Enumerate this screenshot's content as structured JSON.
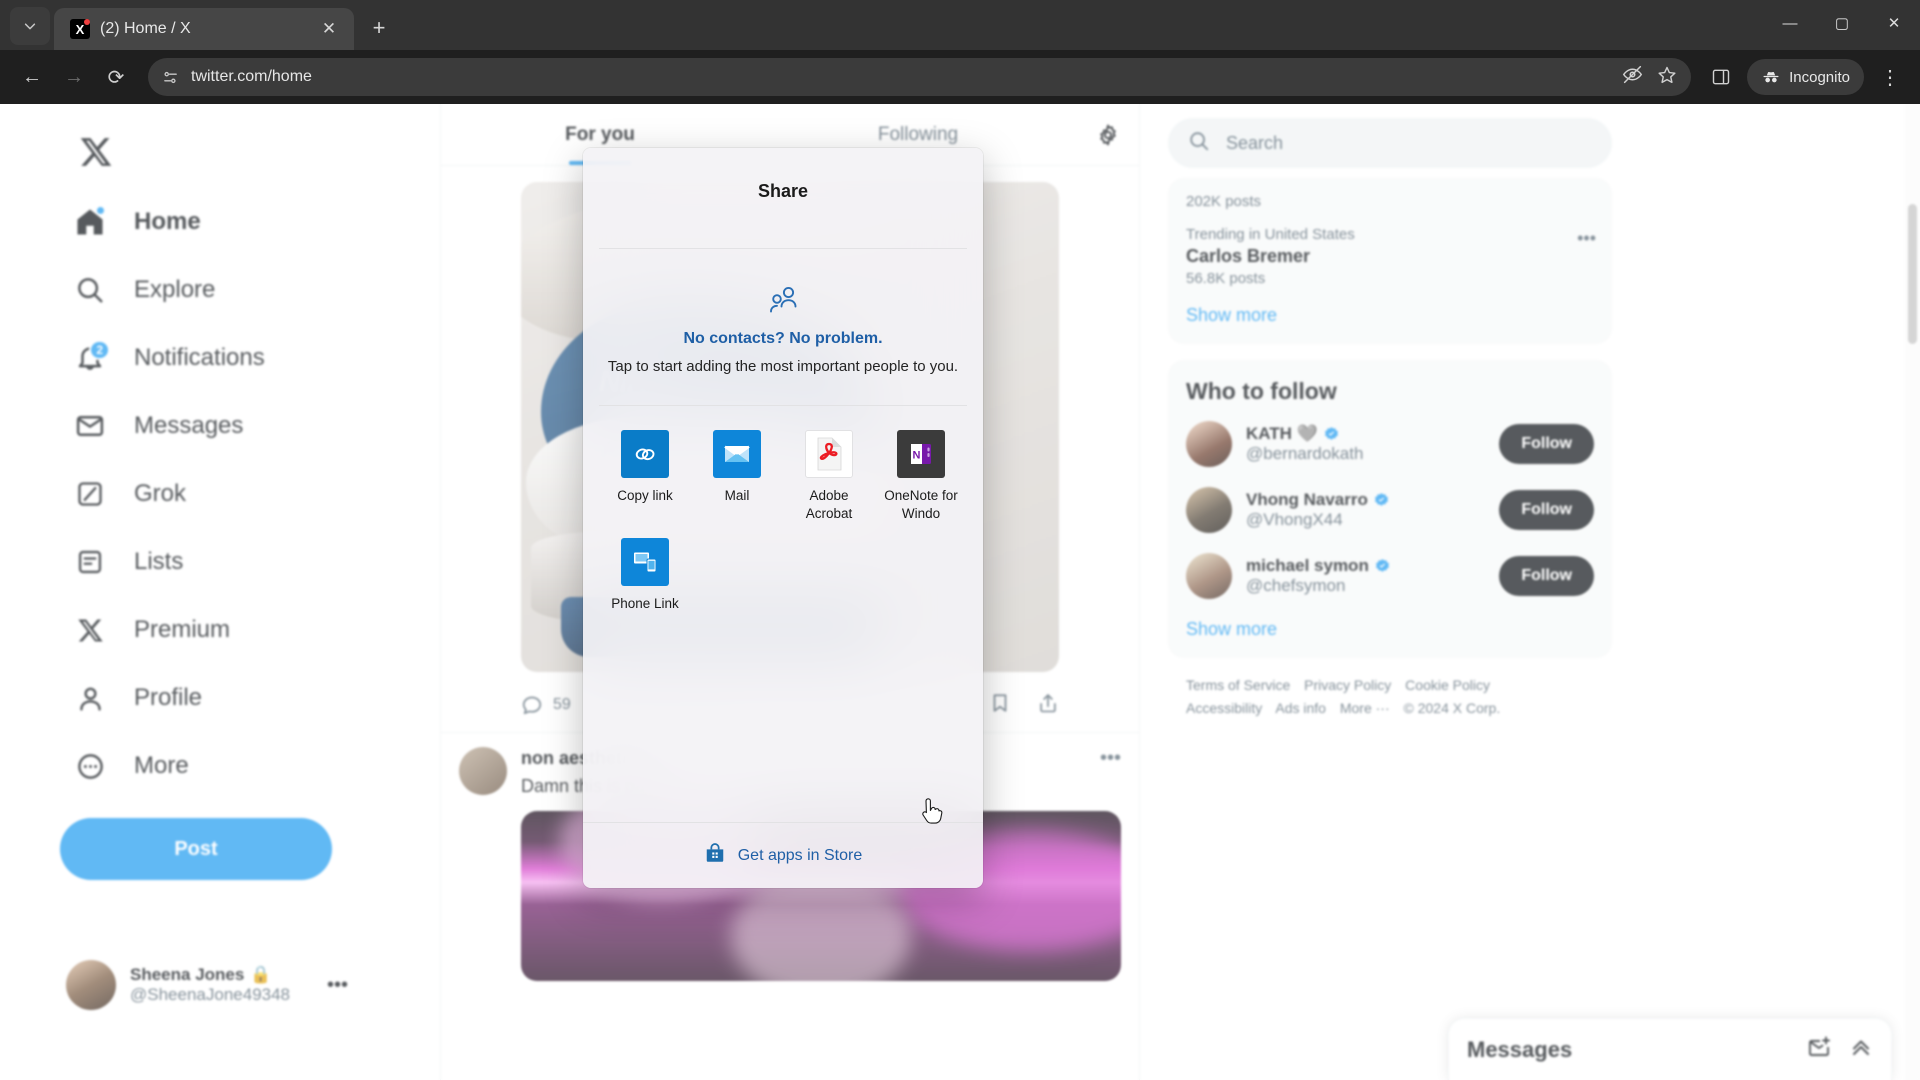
{
  "browser": {
    "tab": {
      "title": "(2) Home / X",
      "favicon_letter": "X"
    },
    "new_tab_label": "+",
    "nav": {
      "back": "←",
      "forward": "→",
      "reload": "⟳"
    },
    "omnibox": {
      "url": "twitter.com/home"
    },
    "incognito_label": "Incognito",
    "window_controls": {
      "minimize": "—",
      "maximize": "▢",
      "close": "✕"
    }
  },
  "sidebar": {
    "logo": "X",
    "items": [
      {
        "label": "Home",
        "icon": "home-icon",
        "badge": "",
        "active": true
      },
      {
        "label": "Explore",
        "icon": "search-icon",
        "badge": ""
      },
      {
        "label": "Notifications",
        "icon": "bell-icon",
        "badge": "2"
      },
      {
        "label": "Messages",
        "icon": "envelope-icon",
        "badge": ""
      },
      {
        "label": "Grok",
        "icon": "grok-icon",
        "badge": ""
      },
      {
        "label": "Lists",
        "icon": "lists-icon",
        "badge": ""
      },
      {
        "label": "Premium",
        "icon": "x-premium-icon",
        "badge": ""
      },
      {
        "label": "Profile",
        "icon": "person-icon",
        "badge": ""
      },
      {
        "label": "More",
        "icon": "more-circle-icon",
        "badge": ""
      }
    ],
    "post_button": "Post",
    "account": {
      "name": "Sheena Jones",
      "handle": "@SheenaJone49348",
      "lock": "🔒",
      "more": "•••"
    }
  },
  "feed": {
    "tabs": [
      {
        "label": "For you",
        "active": true
      },
      {
        "label": "Following",
        "active": false
      }
    ],
    "settings_icon": "gear-icon",
    "post1": {
      "reply_count": "59",
      "icons": [
        "reply-icon",
        "retweet-icon",
        "like-icon",
        "views-icon",
        "bookmark-icon",
        "share-icon"
      ]
    },
    "post2": {
      "author": "non aesthetic thi",
      "text": "Damn this is pain"
    }
  },
  "rightbar": {
    "search": {
      "placeholder": "Search",
      "icon": "search-icon"
    },
    "trending": {
      "top_count": "202K posts",
      "item": {
        "meta": "Trending in United States",
        "name": "Carlos Bremer",
        "count": "56.8K posts",
        "more": "•••"
      },
      "show_more": "Show more"
    },
    "who_to_follow": {
      "title": "Who to follow",
      "people": [
        {
          "name": "KATH 🩶",
          "handle": "@bernardokath",
          "button": "Follow",
          "verified": true
        },
        {
          "name": "Vhong Navarro",
          "handle": "@VhongX44",
          "button": "Follow",
          "verified": true
        },
        {
          "name": "michael symon",
          "handle": "@chefsymon",
          "button": "Follow",
          "verified": true
        }
      ],
      "show_more": "Show more"
    },
    "legal": {
      "line1": [
        "Terms of Service",
        "Privacy Policy",
        "Cookie Policy"
      ],
      "line2": [
        "Accessibility",
        "Ads info",
        "More ···",
        "© 2024 X Corp."
      ]
    },
    "messages_bar": {
      "title": "Messages",
      "icons": [
        "new-message-icon",
        "expand-icon"
      ]
    }
  },
  "share_dialog": {
    "title": "Share",
    "contacts": {
      "icon": "people-icon",
      "headline": "No contacts? No problem.",
      "subtext": "Tap to start adding the most important people to you."
    },
    "apps": [
      {
        "label": "Copy link",
        "icon": "link-icon",
        "bg": "#0a7cc8"
      },
      {
        "label": "Mail",
        "icon": "mail-icon",
        "bg": "#0e86d9"
      },
      {
        "label": "Adobe Acrobat",
        "icon": "adobe-acrobat-icon",
        "bg": "#ffffff"
      },
      {
        "label": "OneNote for Windo",
        "icon": "onenote-icon",
        "bg": "#3b3b3b"
      },
      {
        "label": "Phone Link",
        "icon": "phone-link-icon",
        "bg": "#0e86d9"
      }
    ],
    "footer": {
      "label": "Get apps in Store",
      "icon": "store-icon"
    }
  },
  "colors": {
    "accent_blue": "#1d9bf0",
    "verified_blue": "#1d9bf0",
    "text_primary": "#0f1419",
    "text_secondary": "#536471",
    "dark_button": "#0f1419",
    "chrome_dark": "#1f1f1f",
    "win_link_blue": "#1f5fa6"
  }
}
